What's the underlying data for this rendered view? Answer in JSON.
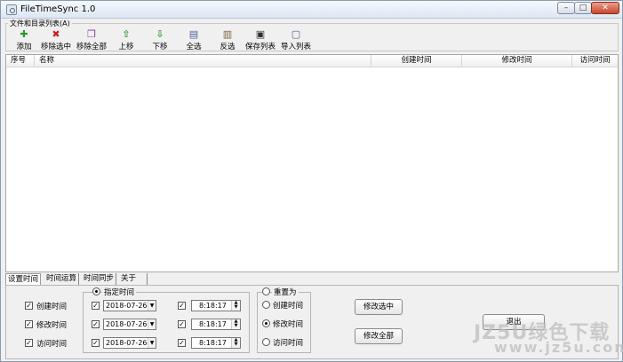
{
  "window": {
    "title": "FileTimeSync 1.0",
    "minimize": "–",
    "maximize": "□",
    "close": "✕"
  },
  "group": {
    "title": "文件和目录列表(A)"
  },
  "toolbar": [
    {
      "label": "添加",
      "icon": "plus-icon",
      "glyph": "✚",
      "color": "#2a9a2a"
    },
    {
      "label": "移除选中",
      "icon": "remove-x-icon",
      "glyph": "✖",
      "color": "#c02020"
    },
    {
      "label": "移除全部",
      "icon": "remove-all-icon",
      "glyph": "❐",
      "color": "#8040a0"
    },
    {
      "label": "上移",
      "icon": "arrow-up-icon",
      "glyph": "⇧",
      "color": "#3a9a3a"
    },
    {
      "label": "下移",
      "icon": "arrow-down-icon",
      "glyph": "⇩",
      "color": "#3a9a3a"
    },
    {
      "label": "全选",
      "icon": "document-select-all-icon",
      "glyph": "▤",
      "color": "#5060a0"
    },
    {
      "label": "反选",
      "icon": "document-invert-icon",
      "glyph": "▥",
      "color": "#806040"
    },
    {
      "label": "保存列表",
      "icon": "save-disk-icon",
      "glyph": "▣",
      "color": "#303030"
    },
    {
      "label": "导入列表",
      "icon": "import-document-icon",
      "glyph": "▢",
      "color": "#506080"
    }
  ],
  "columns": [
    "序号",
    "名称",
    "创建时间",
    "修改时间",
    "访问时间"
  ],
  "tabs": [
    "设置时间",
    "时间运算",
    "时间同步",
    "关于"
  ],
  "checks": [
    {
      "label": "创建时间",
      "checked": true
    },
    {
      "label": "修改时间",
      "checked": true
    },
    {
      "label": "访问时间",
      "checked": true
    }
  ],
  "specified": {
    "title": "指定时间",
    "rows": [
      {
        "date": "2018-07-26",
        "time": "8:18:17",
        "date_checked": true,
        "time_checked": true
      },
      {
        "date": "2018-07-26",
        "time": "8:18:17",
        "date_checked": true,
        "time_checked": true
      },
      {
        "date": "2018-07-26",
        "time": "8:18:17",
        "date_checked": true,
        "time_checked": true
      }
    ]
  },
  "reset": {
    "title": "重置为",
    "options": [
      "创建时间",
      "修改时间",
      "访问时间"
    ],
    "selected": 1
  },
  "buttons": {
    "modify_selected": "修改选中",
    "modify_all": "修改全部",
    "exit": "退出"
  },
  "watermark": {
    "line1": "JZ5U绿色下载",
    "line2": "www.jz5u.com"
  }
}
